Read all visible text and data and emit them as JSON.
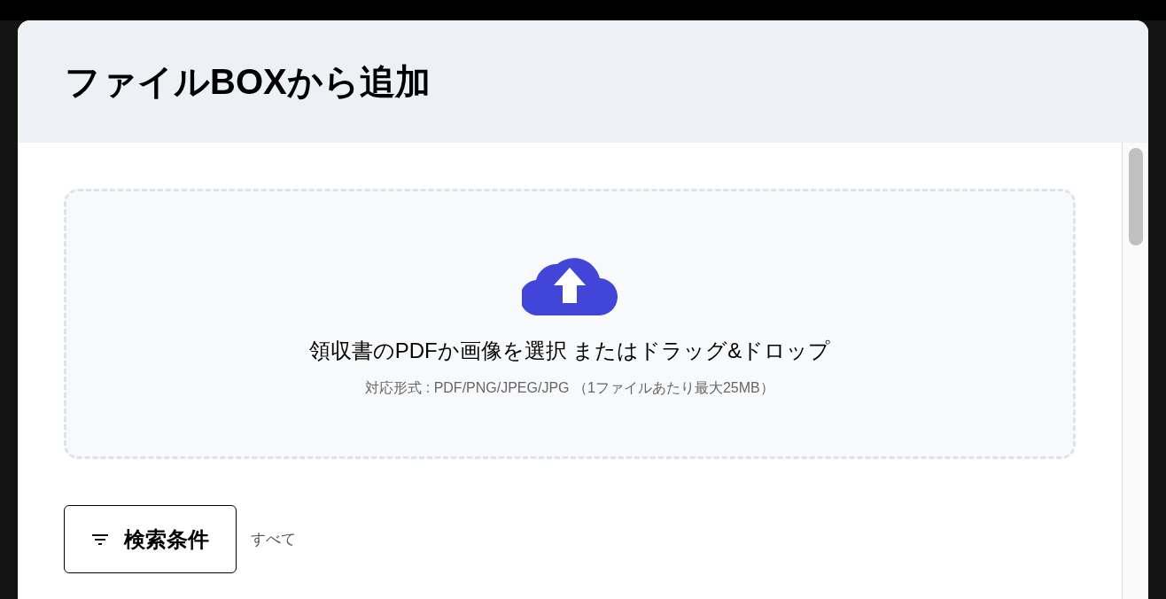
{
  "dialog": {
    "title": "ファイルBOXから追加"
  },
  "dropzone": {
    "instruction": "領収書のPDFか画像を選択 またはドラッグ&ドロップ",
    "formats": "対応形式 : PDF/PNG/JPEG/JPG （1ファイルあたり最大25MB）"
  },
  "filter": {
    "button": "検索条件",
    "value": "すべて"
  }
}
